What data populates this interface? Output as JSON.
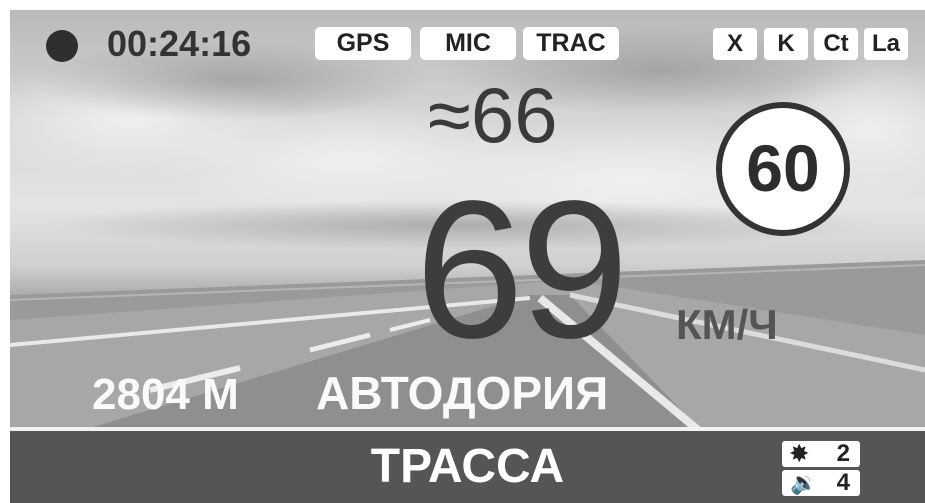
{
  "status": {
    "recording_icon": "record-dot-icon",
    "timer": "00:24:16",
    "tags": [
      "GPS",
      "MIC",
      "TRAC"
    ],
    "bands": [
      "X",
      "K",
      "Ct",
      "La"
    ]
  },
  "speed": {
    "average_symbol": "≈",
    "average": "66",
    "current": "69",
    "unit": "КМ/Ч",
    "limit": "60"
  },
  "camera": {
    "distance": "2804 М",
    "type": "АВТОДОРИЯ"
  },
  "footer": {
    "mode": "ТРАССА",
    "brightness_icon": "brightness-icon",
    "brightness": "2",
    "volume_icon": "speaker-icon",
    "volume": "4"
  },
  "colors": {
    "text_dark": "#333333",
    "bar": "#555555",
    "badge_bg": "#ffffff"
  }
}
